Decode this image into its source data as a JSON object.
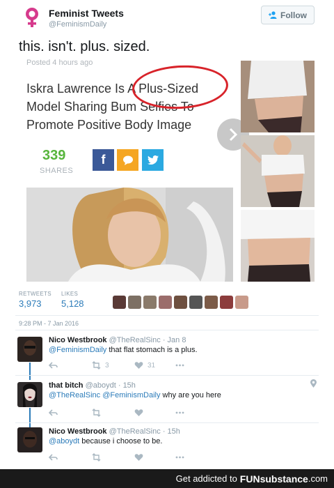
{
  "account": {
    "name": "Feminist Tweets",
    "handle": "@FeminismDaily",
    "follow_label": "Follow",
    "logo_icon": "female-symbol-icon",
    "logo_color": "#d63a8c"
  },
  "tweet": {
    "text": "this. isn't. plus. sized."
  },
  "article": {
    "posted": "Posted 4 hours ago",
    "headline": "Iskra Lawrence Is A Plus-Sized Model Sharing Bum Selfies To Promote Positive Body Image",
    "shares_count": "339",
    "shares_label": "SHARES",
    "share_buttons": [
      {
        "icon": "facebook-icon",
        "glyph": "f",
        "color": "#3b5998"
      },
      {
        "icon": "chat-bubble-icon",
        "glyph": "",
        "color": "#f5a623"
      },
      {
        "icon": "twitter-bird-icon",
        "glyph": "",
        "color": "#2ba9e1"
      }
    ],
    "next_icon": "chevron-right-icon",
    "highlight_color": "#d8232a"
  },
  "stats": {
    "retweets_label": "RETWEETS",
    "retweets_value": "3,973",
    "likes_label": "LIKES",
    "likes_value": "5,128",
    "liker_count": 9
  },
  "timestamp": "9:28 PM - 7 Jan 2016",
  "replies": [
    {
      "name": "Nico Westbrook",
      "handle": "@TheRealSinc",
      "time": "Jan 8",
      "mention": "@FeminismDaily",
      "text": " that flat stomach is a plus.",
      "retweets": "3",
      "likes": "31"
    },
    {
      "name": "that bitch",
      "handle": "@aboydt",
      "time": "15h",
      "mention": "@TheRealSinc @FeminismDaily",
      "text": " why are you here",
      "retweets": "",
      "likes": ""
    },
    {
      "name": "Nico Westbrook",
      "handle": "@TheRealSinc",
      "time": "15h",
      "mention": "@aboydt",
      "text": " because i choose to be.",
      "retweets": "",
      "likes": ""
    }
  ],
  "footer": {
    "prefix": "Get addicted to",
    "brand": "FUNsubstance",
    "suffix": ".com"
  }
}
